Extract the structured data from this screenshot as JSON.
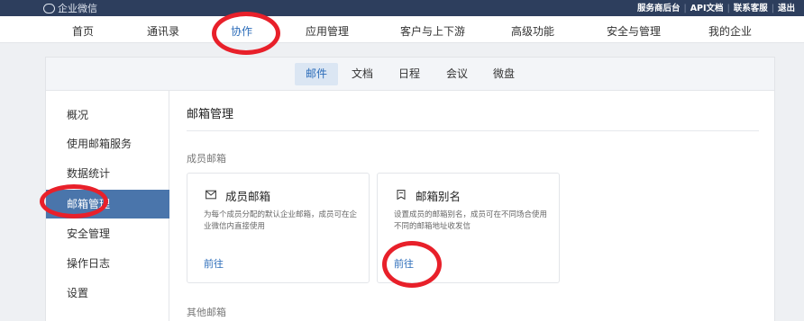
{
  "topbar": {
    "brand": "企业微信",
    "links": [
      "服务商后台",
      "API文档",
      "联系客服",
      "退出"
    ]
  },
  "mainnav": {
    "items": [
      "首页",
      "通讯录",
      "协作",
      "应用管理",
      "客户与上下游",
      "高级功能",
      "安全与管理",
      "我的企业"
    ],
    "active": "协作"
  },
  "subnav": {
    "tabs": [
      "邮件",
      "文档",
      "日程",
      "会议",
      "微盘"
    ],
    "active": "邮件"
  },
  "sidebar": {
    "items": [
      "概况",
      "使用邮箱服务",
      "数据统计",
      "邮箱管理",
      "安全管理",
      "操作日志",
      "设置"
    ],
    "active": "邮箱管理"
  },
  "main": {
    "title": "邮箱管理",
    "section_member": "成员邮箱",
    "section_other": "其他邮箱",
    "cards": [
      {
        "icon": "mail-icon",
        "title": "成员邮箱",
        "desc": "为每个成员分配的默认企业邮箱，成员可在企业微信内直接使用",
        "link": "前往"
      },
      {
        "icon": "bookmark-icon",
        "title": "邮箱别名",
        "desc": "设置成员的邮箱别名，成员可在不同场合使用不同的邮箱地址收发信",
        "link": "前往"
      }
    ]
  },
  "annotation_color": "#e8202a"
}
